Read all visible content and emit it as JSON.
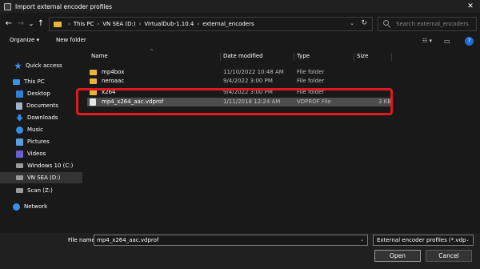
{
  "window": {
    "title": "Import external encoder profiles",
    "close_glyph": "✕"
  },
  "nav": {
    "back": "←",
    "forward": "→",
    "recent": "⌄",
    "up": "↑",
    "breadcrumbs": [
      "This PC",
      "VN SEA (D:)",
      "VirtualDub-1.10.4",
      "external_encoders"
    ],
    "separator": "›",
    "dropdown": "⌄",
    "refresh": "↻",
    "search_placeholder": "Search external_encoders"
  },
  "toolbar": {
    "organize": "Organize ▾",
    "new_folder": "New folder",
    "view": "☷ ▾",
    "pane": "▭",
    "help": "?"
  },
  "sidebar": {
    "items": [
      {
        "label": "Quick access",
        "icon": "star-icon",
        "color": "#3a8fe6"
      },
      {
        "label": "This PC",
        "icon": "computer-icon",
        "color": "#3a8fe6"
      },
      {
        "label": "Desktop",
        "icon": "desktop-icon",
        "color": "#2f7fd6"
      },
      {
        "label": "Documents",
        "icon": "documents-icon",
        "color": "#9fb4c9"
      },
      {
        "label": "Downloads",
        "icon": "downloads-icon",
        "color": "#2f8fe6"
      },
      {
        "label": "Music",
        "icon": "music-icon",
        "color": "#2f8fe6"
      },
      {
        "label": "Pictures",
        "icon": "pictures-icon",
        "color": "#5aa0e0"
      },
      {
        "label": "Videos",
        "icon": "videos-icon",
        "color": "#6b5fd1"
      },
      {
        "label": "Windows 10 (C:)",
        "icon": "drive-icon",
        "color": "#9a9a9a"
      },
      {
        "label": "VN SEA (D:)",
        "icon": "drive-icon",
        "color": "#9a9a9a"
      },
      {
        "label": "Scan (Z:)",
        "icon": "network-drive-icon",
        "color": "#9a9a9a"
      },
      {
        "label": "Network",
        "icon": "network-icon",
        "color": "#3a8fe6"
      }
    ]
  },
  "columns": {
    "name": "Name",
    "date": "Date modified",
    "type": "Type",
    "size": "Size",
    "sort": "^"
  },
  "files": [
    {
      "name": "mp4box",
      "date": "11/10/2022 10:48 AM",
      "type": "File folder",
      "size": "",
      "kind": "folder"
    },
    {
      "name": "neroaac",
      "date": "9/4/2022 3:00 PM",
      "type": "File folder",
      "size": "",
      "kind": "folder"
    },
    {
      "name": "x264",
      "date": "9/4/2022 3:00 PM",
      "type": "File folder",
      "size": "",
      "kind": "folder"
    },
    {
      "name": "mp4_x264_aac.vdprof",
      "date": "1/11/2018 12:24 AM",
      "type": "VDPROF File",
      "size": "3 KB",
      "kind": "file"
    }
  ],
  "footer": {
    "file_name_label": "File name:",
    "file_name_value": "mp4_x264_aac.vdprof",
    "filter": "External encoder profiles (*.vdp",
    "open": "Open",
    "cancel": "Cancel",
    "dropdown": "⌄"
  },
  "accent": {
    "highlight": "#e0191e",
    "folder": "#e8b43b",
    "selection": "#4d4d4d"
  }
}
